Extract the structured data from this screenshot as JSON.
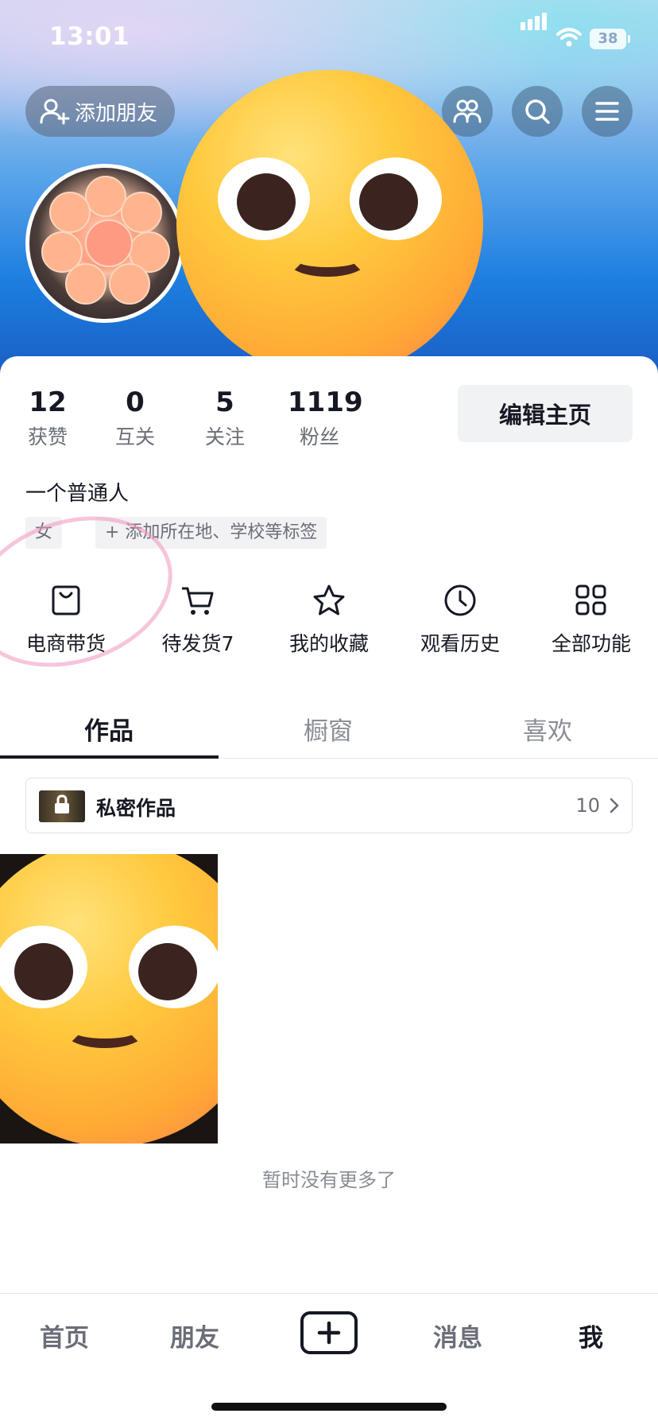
{
  "status_bar": {
    "time": "13:01",
    "battery": "38"
  },
  "header": {
    "add_friend_label": "添加朋友",
    "buttons": [
      "friends-icon",
      "search-icon",
      "menu-icon"
    ]
  },
  "profile": {
    "stats": [
      {
        "value": "12",
        "label": "获赞"
      },
      {
        "value": "0",
        "label": "互关"
      },
      {
        "value": "5",
        "label": "关注"
      },
      {
        "value": "1119",
        "label": "粉丝"
      }
    ],
    "edit_label": "编辑主页",
    "bio": "一个普通人",
    "tags": [
      "女",
      "+ 添加所在地、学校等标签"
    ]
  },
  "features": [
    {
      "label": "电商带货",
      "icon": "bag-icon"
    },
    {
      "label": "待发货7",
      "icon": "cart-icon"
    },
    {
      "label": "我的收藏",
      "icon": "star-icon"
    },
    {
      "label": "观看历史",
      "icon": "clock-icon"
    },
    {
      "label": "全部功能",
      "icon": "grid-icon"
    }
  ],
  "tabs": [
    {
      "label": "作品",
      "active": true
    },
    {
      "label": "橱窗",
      "active": false
    },
    {
      "label": "喜欢",
      "active": false
    }
  ],
  "private_works": {
    "label": "私密作品",
    "count": "10"
  },
  "no_more_text": "暂时没有更多了",
  "bottom_nav": [
    {
      "label": "首页",
      "active": false
    },
    {
      "label": "朋友",
      "active": false
    },
    {
      "label": "+",
      "active": false
    },
    {
      "label": "消息",
      "active": false
    },
    {
      "label": "我",
      "active": true
    }
  ],
  "colors": {
    "text_primary": "#161823",
    "text_secondary": "#6b6e78",
    "header_blue": "#1d7ee0"
  }
}
